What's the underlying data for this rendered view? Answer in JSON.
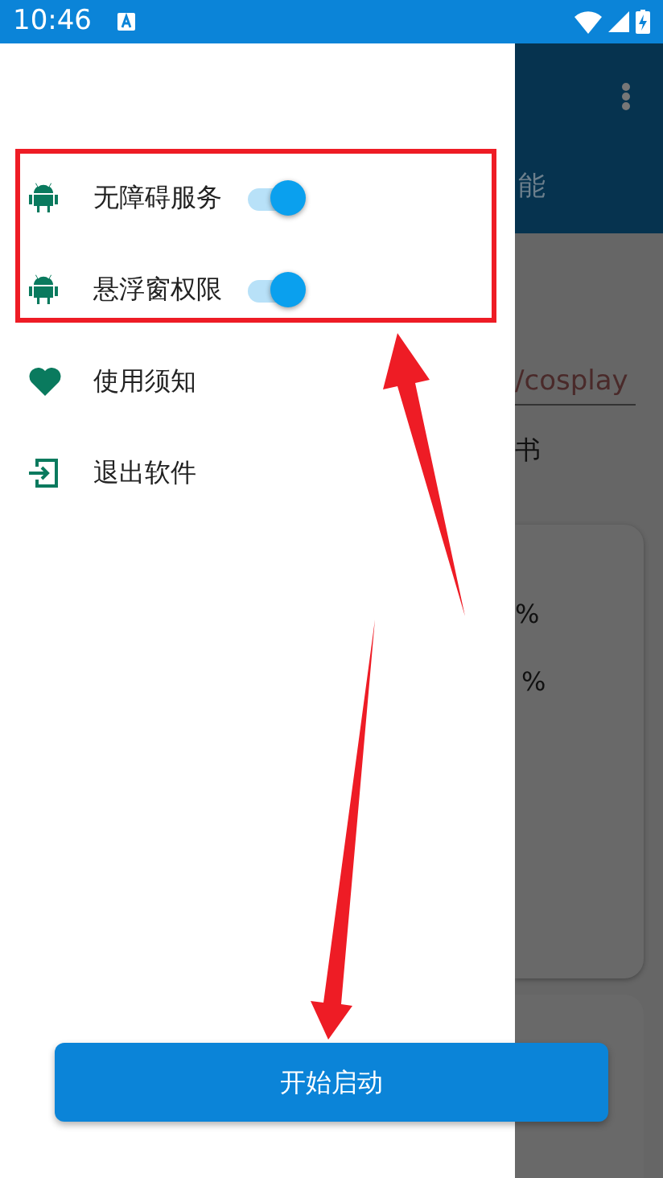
{
  "status_bar": {
    "time": "10:46"
  },
  "drawer": {
    "items": [
      {
        "kind": "switch",
        "label": "无障碍服务",
        "on": true
      },
      {
        "kind": "switch",
        "label": "悬浮窗权限",
        "on": true
      },
      {
        "kind": "link",
        "label": "使用须知"
      },
      {
        "kind": "link",
        "label": "退出软件"
      }
    ]
  },
  "background": {
    "toolbar_text": "能",
    "field_value": "/cosplay",
    "label": "书",
    "readings": [
      "%",
      "%"
    ]
  },
  "start_button": {
    "label": "开始启动"
  }
}
